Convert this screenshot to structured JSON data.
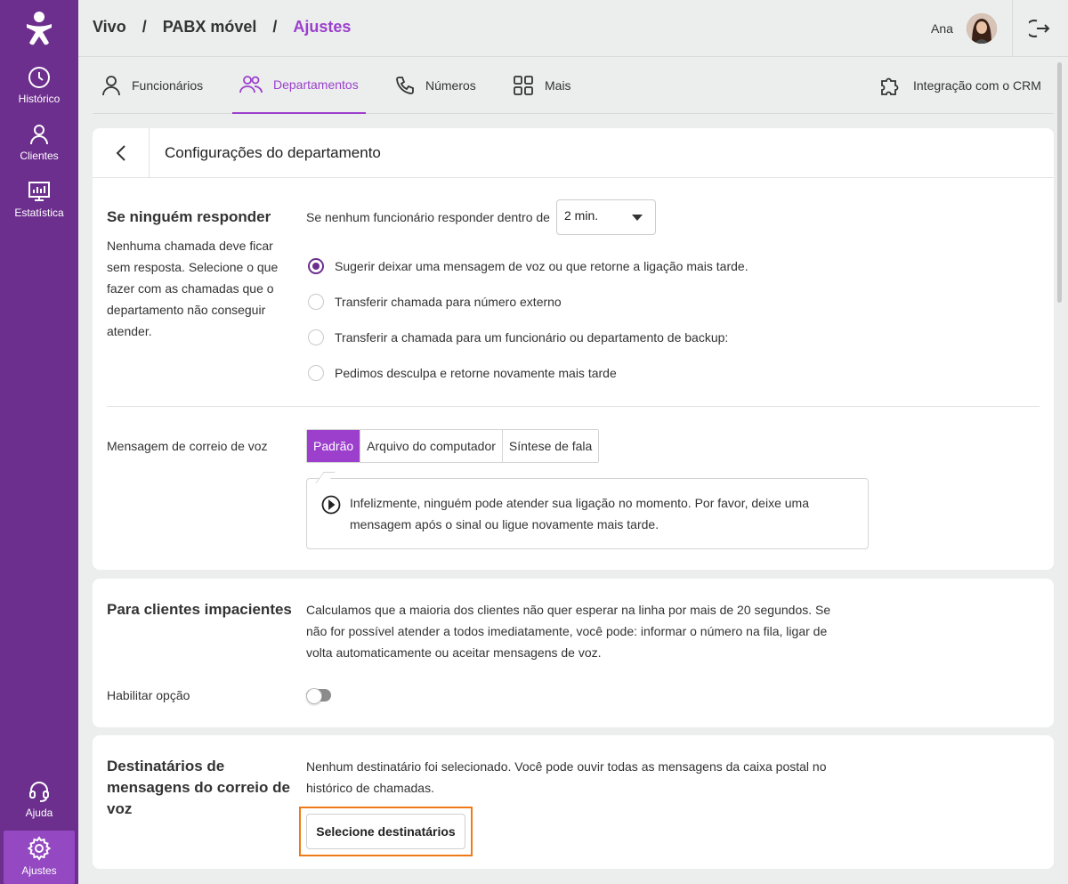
{
  "sidebar": {
    "items": [
      {
        "label": "Histórico",
        "icon": "clock-icon"
      },
      {
        "label": "Clientes",
        "icon": "user-icon"
      },
      {
        "label": "Estatística",
        "icon": "chart-icon"
      }
    ],
    "bottom": [
      {
        "label": "Ajuda",
        "icon": "headset-icon"
      },
      {
        "label": "Ajustes",
        "icon": "gear-icon",
        "active": true
      }
    ]
  },
  "header": {
    "breadcrumb": [
      "Vivo",
      "PABX móvel",
      "Ajustes"
    ],
    "separator": "/",
    "user_name": "Ana"
  },
  "tabs": [
    {
      "label": "Funcionários",
      "icon": "person-icon"
    },
    {
      "label": "Departamentos",
      "icon": "group-icon",
      "active": true
    },
    {
      "label": "Números",
      "icon": "phone-icon"
    },
    {
      "label": "Mais",
      "icon": "grid-icon"
    },
    {
      "label": "Integração com o CRM",
      "icon": "puzzle-icon"
    }
  ],
  "dept": {
    "title": "Configurações do departamento",
    "no_answer": {
      "title": "Se ninguém responder",
      "description": "Nenhuma chamada deve ficar sem resposta. Selecione o que fazer com as chamadas que o departamento não conseguir atender.",
      "timeout_label": "Se nenhum funcionário responder dentro de",
      "timeout_value": "2 min.",
      "options": [
        {
          "label": "Sugerir deixar uma mensagem de voz ou que retorne a ligação mais tarde.",
          "checked": true
        },
        {
          "label": "Transferir chamada para número externo",
          "checked": false
        },
        {
          "label": "Transferir a chamada para um funcionário ou departamento de backup:",
          "checked": false
        },
        {
          "label": "Pedimos desculpa e retorne novamente mais tarde",
          "checked": false
        }
      ]
    },
    "voicemail": {
      "label": "Mensagem de correio de voz",
      "modes": [
        "Padrão",
        "Arquivo do computador",
        "Síntese de fala"
      ],
      "message": "Infelizmente, ninguém pode atender sua ligação no momento. Por favor, deixe uma mensagem após o sinal ou ligue novamente mais tarde."
    }
  },
  "impatient": {
    "title": "Para clientes impacientes",
    "description": "Calculamos que a maioria dos clientes não quer esperar na linha por mais de 20 segundos. Se não for possível atender a todos imediatamente, você pode: informar o número na fila, ligar de volta automaticamente ou aceitar mensagens de voz.",
    "enable_label": "Habilitar opção",
    "enabled": false
  },
  "recipients": {
    "title": "Destinatários de mensagens do correio de voz",
    "description": "Nenhum destinatário foi selecionado. Você pode ouvir todas as mensagens da caixa postal no histórico de chamadas.",
    "button_label": "Selecione destinatários"
  },
  "colors": {
    "sidebar": "#6d2f8e",
    "accent": "#9b3fcc",
    "highlight": "#f07a1a"
  }
}
